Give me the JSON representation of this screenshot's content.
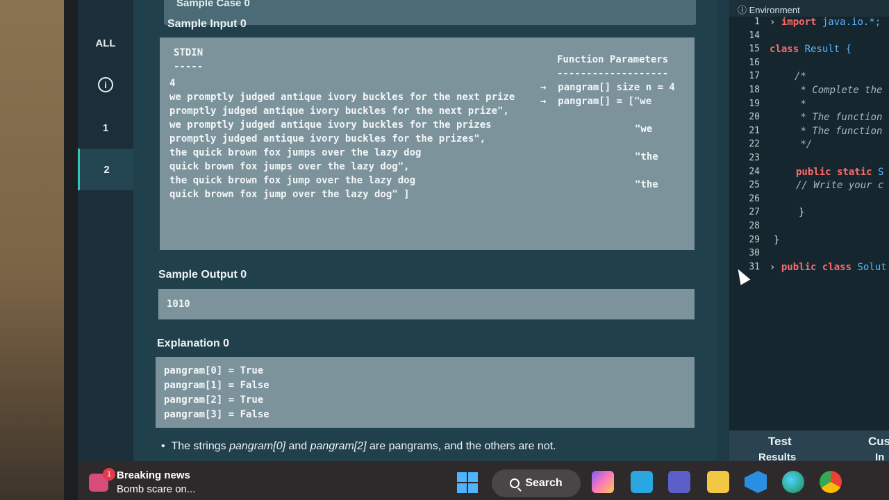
{
  "rail": {
    "items": [
      "ALL",
      "i",
      "1",
      "2"
    ]
  },
  "problem": {
    "sample_case_title": "Sample Case 0",
    "sample_input_heading": "Sample Input 0",
    "stdin_label": "STDIN",
    "stdin_rule": "-----",
    "stdin_lines": [
      "4",
      "we promptly judged antique ivory buckles for the next prize",
      "promptly judged antique ivory buckles for the next prize\",",
      "we promptly judged antique ivory buckles for the prizes",
      "promptly judged antique ivory buckles for the prizes\",",
      "the quick brown fox jumps over the lazy dog",
      "quick brown fox jumps over the lazy dog\",",
      "the quick brown fox jump over the lazy dog",
      "quick brown fox jump over the lazy dog\" ]"
    ],
    "function_params_label": "Function Parameters",
    "function_params_rule": "-------------------",
    "params": [
      "→  pangram[] size n = 4",
      "→  pangram[] = [\"we"
    ],
    "param_fragments": [
      "\"we",
      "\"the",
      "\"the"
    ],
    "sample_output_heading": "Sample Output 0",
    "sample_output_value": "1010",
    "explanation_heading": "Explanation 0",
    "explanation_lines": [
      "pangram[0] = True",
      "pangram[1] = False",
      "pangram[2] = True",
      "pangram[3] = False"
    ],
    "bullet_prefix": "The strings ",
    "bullet_em1": "pangram[0]",
    "bullet_mid": " and ",
    "bullet_em2": "pangram[2]",
    "bullet_suffix": " are pangrams, and the others are not."
  },
  "editor": {
    "tab_label": "Environment",
    "line_numbers": [
      "1",
      "14",
      "15",
      "16",
      "17",
      "18",
      "19",
      "20",
      "21",
      "22",
      "23",
      "24",
      "25",
      "26",
      "27",
      "28",
      "29",
      "30",
      "31"
    ],
    "import_kw": "import",
    "import_rest": " java.io.*;",
    "class_kw": "class",
    "class_name": " Result {",
    "comment_open": "/*",
    "comment_1": " * Complete the",
    "comment_star": " *",
    "comment_2": " * The function",
    "comment_3": " * The function",
    "comment_close": " */",
    "ps_kw": "public static",
    "ps_rest": " S",
    "write_comment": "// Write your c",
    "close_brace_inner": "}",
    "close_brace_outer": "}",
    "pub_class_kw": "public class",
    "pub_class_rest": " Solut",
    "bottom_test": "Test",
    "bottom_results": "Results",
    "bottom_cus": "Cus",
    "bottom_in": "In"
  },
  "taskbar": {
    "news_badge": "1",
    "news_title": "Breaking news",
    "news_sub": "Bomb scare on...",
    "search_label": "Search"
  }
}
